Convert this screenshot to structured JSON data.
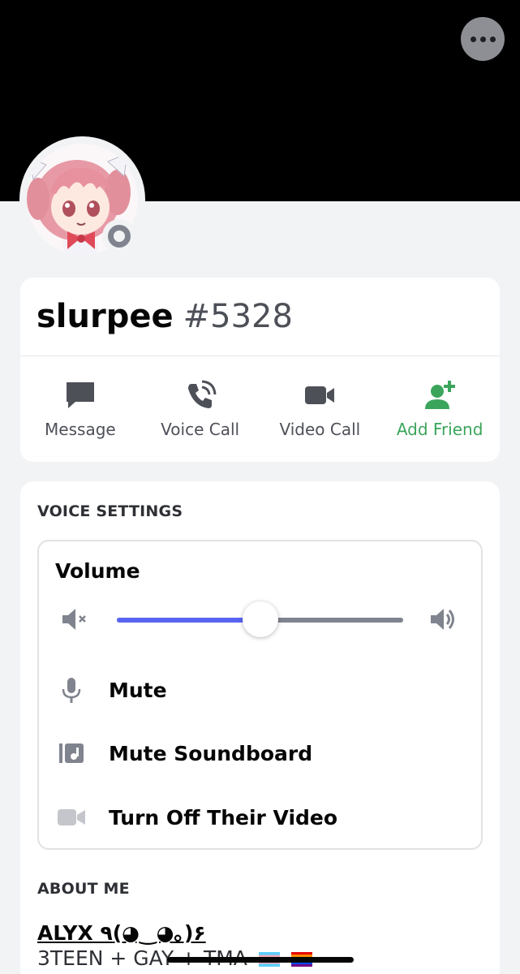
{
  "profile": {
    "username": "slurpee",
    "discriminator": "#5328",
    "status": "offline"
  },
  "icons": {
    "more": "more-icon",
    "message": "chat-bubble-icon",
    "voice_call": "phone-call-icon",
    "video_call": "video-camera-icon",
    "add_friend": "person-add-icon",
    "volume_low": "speaker-muted-icon",
    "volume_high": "speaker-loud-icon",
    "mute": "microphone-icon",
    "mute_soundboard": "soundboard-icon",
    "turn_off_video": "video-camera-icon"
  },
  "actions": [
    {
      "label": "Message"
    },
    {
      "label": "Voice Call"
    },
    {
      "label": "Video Call"
    },
    {
      "label": "Add Friend"
    }
  ],
  "voice_settings": {
    "title": "VOICE SETTINGS",
    "volume_label": "Volume",
    "volume_percent": 50,
    "options": [
      {
        "label": "Mute"
      },
      {
        "label": "Mute Soundboard"
      },
      {
        "label": "Turn Off Their Video"
      }
    ]
  },
  "about_me": {
    "title": "ABOUT ME",
    "name_line": "ALYX ٩(◕‿◕｡)۶",
    "bio_line": "3TEEN + GAY + TMA"
  },
  "colors": {
    "accent": "#5865f2",
    "add_friend": "#3ba55c",
    "banner": "#000000",
    "background": "#f2f3f5"
  }
}
